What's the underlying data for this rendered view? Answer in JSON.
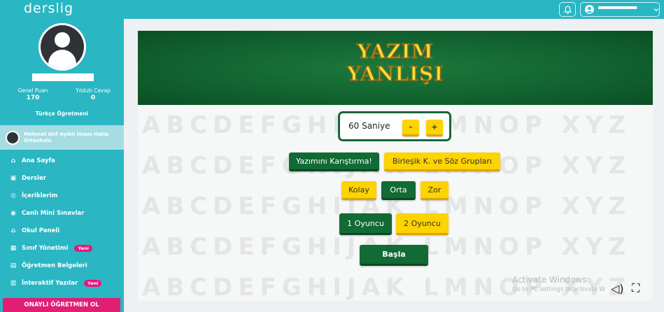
{
  "topbar": {
    "logo": "derslig",
    "bell_icon": "bell-icon",
    "user_icon": "user-icon",
    "user_name": "▀▀▀▀▀▀▀▀",
    "chevron_icon": "chevron-down-icon"
  },
  "sidebar": {
    "stats": [
      {
        "label": "Genel Puan",
        "value": "170"
      },
      {
        "label": "Yıldızlı Cevap",
        "value": "0"
      }
    ],
    "role": "Türkçe Öğretmeni",
    "school": "Mehmet Atıf Aydın İmam Hatip Ortaokulu",
    "menu": [
      {
        "icon": "home-icon",
        "glyph": "⌂",
        "label": "Ana Sayfa",
        "badge": ""
      },
      {
        "icon": "book-icon",
        "glyph": "▣",
        "label": "Dersler",
        "badge": ""
      },
      {
        "icon": "content-icon",
        "glyph": "◎",
        "label": "İçeriklerim",
        "badge": ""
      },
      {
        "icon": "broadcast-icon",
        "glyph": "◉",
        "label": "Canlı Mini Sınavlar",
        "badge": ""
      },
      {
        "icon": "school-icon",
        "glyph": "⌂",
        "label": "Okul Paneli",
        "badge": ""
      },
      {
        "icon": "class-icon",
        "glyph": "▦",
        "label": "Sınıf Yönetimi",
        "badge": "Yeni"
      },
      {
        "icon": "document-icon",
        "glyph": "▤",
        "label": "Öğretmen Belgeleri",
        "badge": ""
      },
      {
        "icon": "interactive-icon",
        "glyph": "▥",
        "label": "İnteraktif Yazılar",
        "badge": "Yeni"
      }
    ],
    "cta": "ONAYLI ÖĞRETMEN OL",
    "colors": {
      "primary": "#2ab6c3",
      "badge": "#e9157a",
      "cta": "#e11d74"
    }
  },
  "game": {
    "title_line1": "YAZIM",
    "title_line2": "YANLIŞI",
    "timer": {
      "label": "60 Saniye",
      "minus": "-",
      "plus": "+"
    },
    "modes": [
      "Yazımını Karıştırma!",
      "Birleşik K. ve Söz Grupları"
    ],
    "difficulty": [
      "Kolay",
      "Orta",
      "Zor"
    ],
    "players": [
      "1 Oyuncu",
      "2 Oyuncu"
    ],
    "start": "Başla",
    "colors": {
      "green": "#126a34",
      "yellow": "#fdd300",
      "title": "#f3e03a"
    }
  },
  "overlay": {
    "windows_title": "Activate Windows",
    "windows_sub": "Go to PC settings to activate W",
    "sound_icon": "speaker-icon",
    "fullscreen_icon": "fullscreen-icon"
  }
}
